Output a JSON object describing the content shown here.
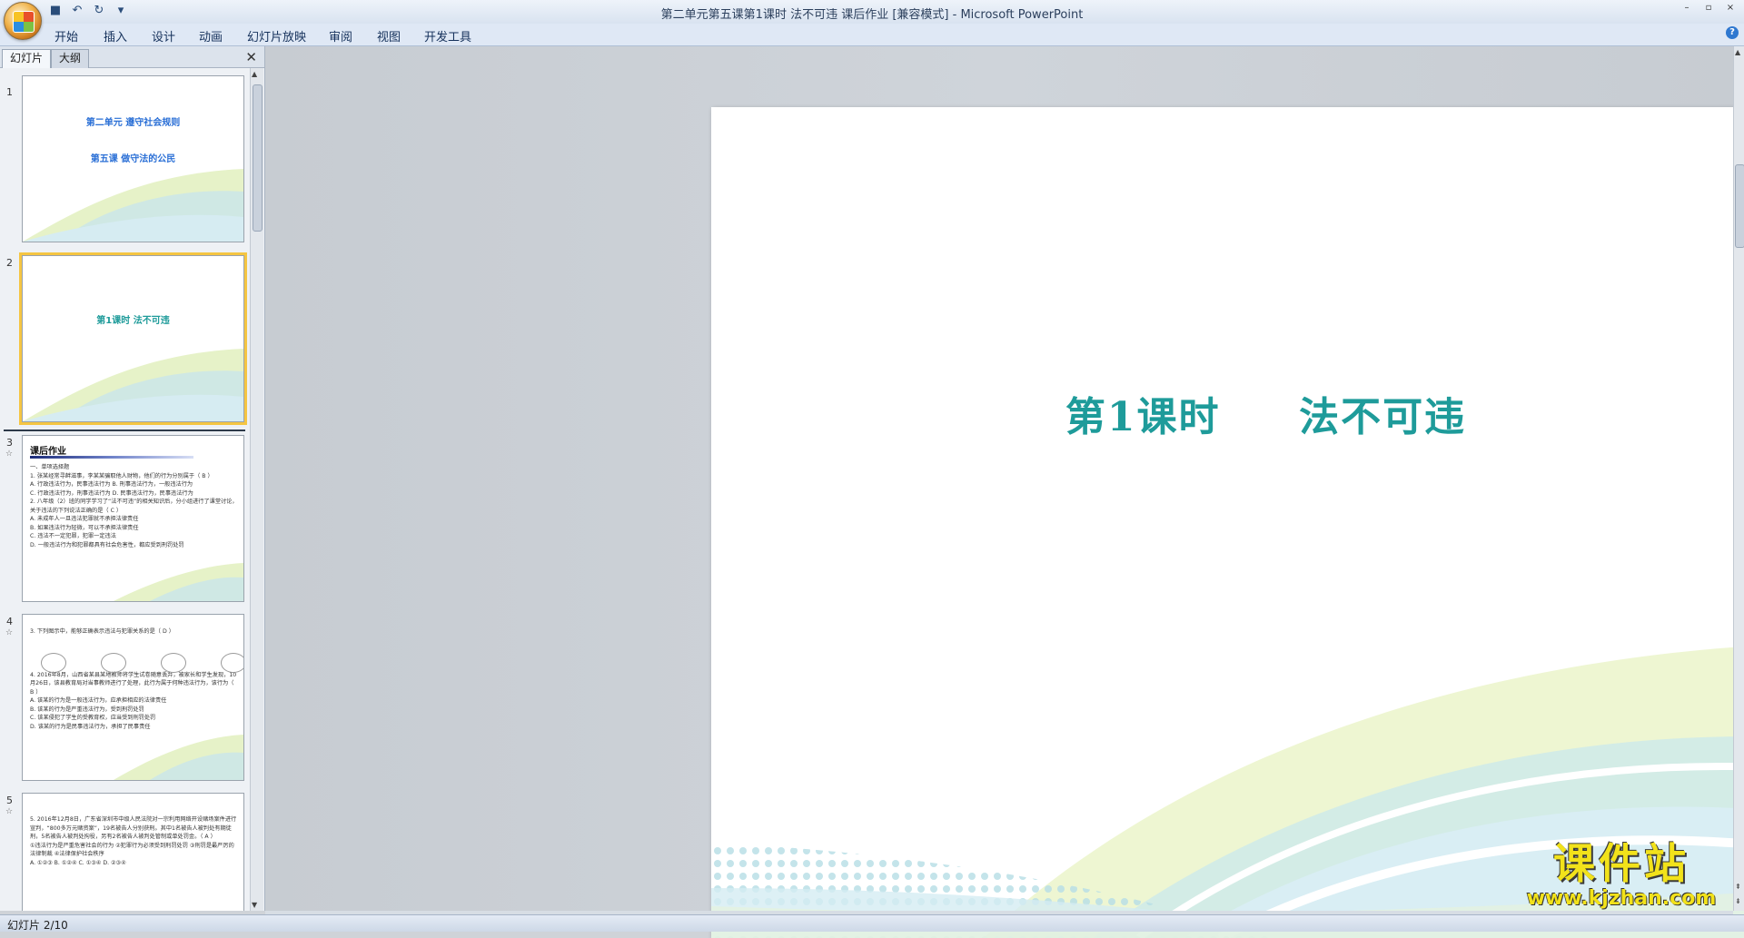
{
  "window": {
    "title": "第二单元第五课第1课时 法不可违 课后作业 [兼容模式] - Microsoft PowerPoint",
    "controls": [
      "–",
      "▫",
      "×"
    ]
  },
  "ribbon": {
    "tabs": [
      "开始",
      "插入",
      "设计",
      "动画",
      "幻灯片放映",
      "审阅",
      "视图",
      "开发工具"
    ]
  },
  "panel": {
    "tabs": [
      "幻灯片",
      "大纲"
    ],
    "slides": [
      {
        "num": "1",
        "line1": "第二单元  遵守社会规则",
        "line2": "第五课  做守法的公民"
      },
      {
        "num": "2",
        "line1": "第1课时    法不可违"
      },
      {
        "num": "3",
        "heading": "课后作业",
        "body": "一、单项选择题\n1. 张某经常寻衅滋事，李某某骗取他人财物，他们的行为分别属于（ B ）\nA. 行政违法行为，民事违法行为    B. 刑事违法行为，一般违法行为\nC. 行政违法行为，刑事违法行为    D. 民事违法行为，民事违法行为\n2. 八年级（2）班的同学学习了“法不可违”的相关知识后，分小组进行了课堂讨论，关于违法的下列说法正确的是（ C ）\nA. 未成年人一旦违法犯罪就不承担法律责任\nB. 如果违法行为轻微，可以不承担法律责任\nC. 违法不一定犯罪，犯罪一定违法\nD. 一般违法行为和犯罪都具有社会危害性，都应受到刑罚处罚"
      },
      {
        "num": "4",
        "body": "3. 下列图示中，能够正确表示违法与犯罪关系的是（ D ）\n\n\n\n\n4. 2016年8月，山西省某县某地教师将学生试卷随意丢弃，被家长和学生发现，10月26日，该县教育局对当事教师进行了处理，此行为属于何种违法行为，该行为（ B ）\nA. 该某的行为是一般违法行为，应承担相应的法律责任\nB. 该某的行为是严重违法行为，受到刑罚处罚\nC. 该某侵犯了学生的受教育权，应当受到刑罚处罚\nD. 该某的行为是民事违法行为，承担了民事责任"
      },
      {
        "num": "5",
        "body": "5. 2016年12月8日，广东省深圳市中级人民法院对一宗利用网络开设赌场案件进行宣判，“800多万元赌资案”，19名被告人分别获刑。其中1名被告人被判处有期徒刑，5名被告人被判处拘役，另有2名被告人被判处管制或单处罚金。（ A ）\n①违法行为是严重危害社会的行为  ②犯罪行为必须受到刑罚处罚  ③刑罚是最严厉的法律制裁  ④法律保护社会秩序\nA. ①②③    B. ①②④    C. ①③④    D. ②③④"
      }
    ]
  },
  "slide": {
    "title_a": "第1课时",
    "title_b": "法不可违"
  },
  "status": {
    "slide_counter": "幻灯片 2/10"
  },
  "watermark": {
    "brand": "课件站",
    "url": "www.kjzhan.com"
  },
  "colors": {
    "title_teal": "#1e9b9a",
    "thumb_title_blue": "#2a6fd6",
    "selection": "#f5c542"
  }
}
